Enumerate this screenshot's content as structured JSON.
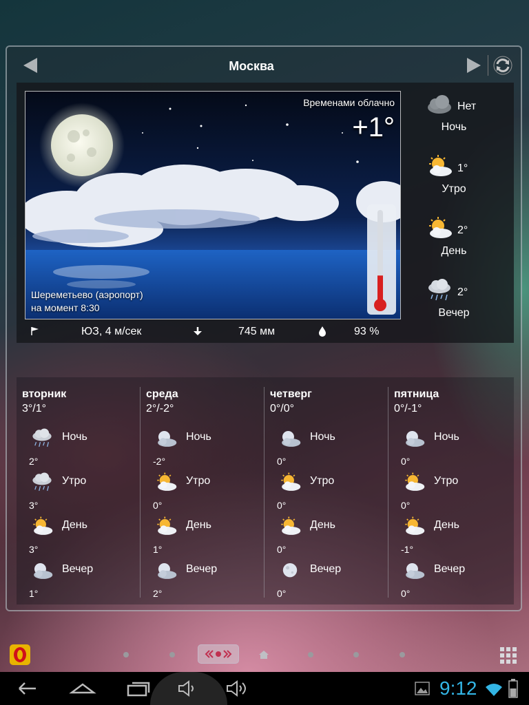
{
  "header": {
    "city": "Москва"
  },
  "current": {
    "condition": "Временами облачно",
    "temperature": "+1°",
    "station": "Шереметьево (аэропорт)",
    "time_label": "на момент 8:30",
    "wind": "ЮЗ, 4 м/сек",
    "pressure": "745 мм",
    "humidity": "93 %",
    "thermometer_level": 0.3
  },
  "today": [
    {
      "label": "Ночь",
      "value": "Нет",
      "icon": "cloudy-night-icon"
    },
    {
      "label": "Утро",
      "value": "1°",
      "icon": "partly-cloudy-icon"
    },
    {
      "label": "День",
      "value": "2°",
      "icon": "partly-cloudy-icon"
    },
    {
      "label": "Вечер",
      "value": "2°",
      "icon": "rain-icon"
    }
  ],
  "forecast": [
    {
      "day": "вторник",
      "range": "3°/1°",
      "slots": [
        {
          "name": "Ночь",
          "temp": "2°",
          "icon": "rain-icon"
        },
        {
          "name": "Утро",
          "temp": "3°",
          "icon": "rain-icon"
        },
        {
          "name": "День",
          "temp": "3°",
          "icon": "partly-cloudy-icon"
        },
        {
          "name": "Вечер",
          "temp": "1°",
          "icon": "moon-cloud-icon"
        }
      ]
    },
    {
      "day": "среда",
      "range": "2°/-2°",
      "slots": [
        {
          "name": "Ночь",
          "temp": "-2°",
          "icon": "moon-cloud-icon"
        },
        {
          "name": "Утро",
          "temp": "0°",
          "icon": "partly-cloudy-icon"
        },
        {
          "name": "День",
          "temp": "1°",
          "icon": "partly-cloudy-icon"
        },
        {
          "name": "Вечер",
          "temp": "2°",
          "icon": "moon-cloud-icon"
        }
      ]
    },
    {
      "day": "четверг",
      "range": "0°/0°",
      "slots": [
        {
          "name": "Ночь",
          "temp": "0°",
          "icon": "moon-cloud-icon"
        },
        {
          "name": "Утро",
          "temp": "0°",
          "icon": "partly-cloudy-icon"
        },
        {
          "name": "День",
          "temp": "0°",
          "icon": "partly-cloudy-icon"
        },
        {
          "name": "Вечер",
          "temp": "0°",
          "icon": "moon-icon"
        }
      ]
    },
    {
      "day": "пятница",
      "range": "0°/-1°",
      "slots": [
        {
          "name": "Ночь",
          "temp": "0°",
          "icon": "moon-cloud-icon"
        },
        {
          "name": "Утро",
          "temp": "0°",
          "icon": "partly-cloudy-icon"
        },
        {
          "name": "День",
          "temp": "-1°",
          "icon": "partly-cloudy-icon"
        },
        {
          "name": "Вечер",
          "temp": "0°",
          "icon": "moon-cloud-icon"
        }
      ]
    }
  ],
  "statusbar": {
    "time": "9:12"
  },
  "colors": {
    "clock": "#33b5e5",
    "sun": "#f7b733",
    "sky": "#0a1a3c"
  }
}
